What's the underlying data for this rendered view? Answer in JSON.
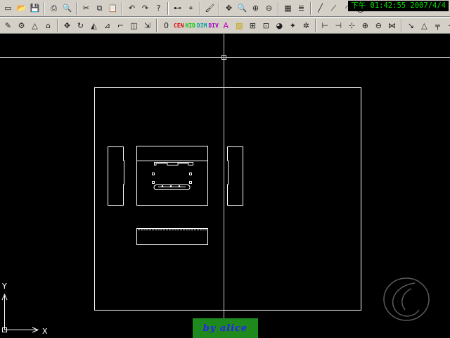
{
  "clock": {
    "text": "下午 01:42:55 2007/4/4"
  },
  "toolbar1": {
    "buttons": [
      {
        "name": "new-icon",
        "glyph": "▭"
      },
      {
        "name": "open-icon",
        "glyph": "📂"
      },
      {
        "name": "save-icon",
        "glyph": "💾"
      },
      {
        "sep": true
      },
      {
        "name": "print-icon",
        "glyph": "⎙"
      },
      {
        "name": "print-preview-icon",
        "glyph": "🔍"
      },
      {
        "sep": true
      },
      {
        "name": "cut-icon",
        "glyph": "✂"
      },
      {
        "name": "copy-icon",
        "glyph": "⧉"
      },
      {
        "name": "paste-icon",
        "glyph": "📋"
      },
      {
        "sep": true
      },
      {
        "name": "undo-icon",
        "glyph": "↶"
      },
      {
        "name": "redo-icon",
        "glyph": "↷"
      },
      {
        "name": "help-icon",
        "glyph": "?"
      },
      {
        "sep": true
      },
      {
        "name": "link-icon",
        "glyph": "⊷"
      },
      {
        "name": "snap-icon",
        "glyph": "⌖"
      },
      {
        "sep": true
      },
      {
        "name": "match-properties-icon",
        "glyph": "🖌"
      },
      {
        "sep": true
      },
      {
        "name": "pan-icon",
        "glyph": "✥"
      },
      {
        "name": "zoom-realtime-icon",
        "glyph": "🔍"
      },
      {
        "name": "zoom-window-icon",
        "glyph": "⊕"
      },
      {
        "name": "zoom-previous-icon",
        "glyph": "⊖"
      },
      {
        "sep": true
      },
      {
        "name": "properties-icon",
        "glyph": "▦"
      },
      {
        "name": "layers-stack-icon",
        "glyph": "≣"
      },
      {
        "sep": true
      },
      {
        "name": "line-icon",
        "glyph": "╱"
      },
      {
        "name": "polyline-icon",
        "glyph": "⟋"
      },
      {
        "name": "arc-icon",
        "glyph": "◜"
      },
      {
        "name": "circle-icon",
        "glyph": "◯"
      },
      {
        "name": "rectangle-icon",
        "glyph": "▭"
      },
      {
        "name": "target-icon",
        "glyph": "⊕"
      }
    ]
  },
  "toolbar2": {
    "buttons": [
      {
        "name": "edit-pencil-icon",
        "glyph": "✎"
      },
      {
        "name": "snap-settings-icon",
        "glyph": "⚙"
      },
      {
        "name": "measure-icon",
        "glyph": "△"
      },
      {
        "name": "region-icon",
        "glyph": "⌂"
      },
      {
        "sep": true
      },
      {
        "name": "move-icon",
        "glyph": "✥"
      },
      {
        "name": "rotate-icon",
        "glyph": "↻"
      },
      {
        "name": "mirror-icon",
        "glyph": "◭"
      },
      {
        "name": "trim-icon",
        "glyph": "⊿"
      },
      {
        "name": "fillet-icon",
        "glyph": "⌐"
      },
      {
        "name": "chamfer-icon",
        "glyph": "◫"
      },
      {
        "name": "stretch-icon",
        "glyph": "⇲"
      },
      {
        "sep": true
      },
      {
        "name": "layer-zero-icon",
        "glyph": "0"
      },
      {
        "name": "layer-cen-button",
        "text": "CEN",
        "color": "#e00000"
      },
      {
        "name": "layer-hid-button",
        "text": "HID",
        "color": "#00c800"
      },
      {
        "name": "layer-dim-button",
        "text": "DIM",
        "color": "#00a0a0"
      },
      {
        "name": "layer-div-button",
        "text": "DIV",
        "color": "#a000c0"
      },
      {
        "name": "text-icon",
        "glyph": "A",
        "color": "#c000c0"
      },
      {
        "name": "hatch-icon",
        "glyph": "▨",
        "color": "#c0a000"
      },
      {
        "name": "block-icon",
        "glyph": "⊞"
      },
      {
        "name": "insert-icon",
        "glyph": "⊡"
      },
      {
        "name": "color-wheel-icon",
        "glyph": "◕"
      },
      {
        "name": "paint-icon",
        "glyph": "✦"
      },
      {
        "name": "star-icon",
        "glyph": "✲"
      },
      {
        "sep": true
      },
      {
        "name": "dim-linear-icon",
        "glyph": "⊢"
      },
      {
        "name": "dim-aligned-icon",
        "glyph": "⊣"
      },
      {
        "name": "dim-ordinate-icon",
        "glyph": "⊹"
      },
      {
        "name": "dim-center-icon",
        "glyph": "⊕"
      },
      {
        "name": "dim-radius-icon",
        "glyph": "⊖"
      },
      {
        "name": "dim-angle-icon",
        "glyph": "⋈"
      },
      {
        "sep": true
      },
      {
        "name": "leader-icon",
        "glyph": "↘"
      },
      {
        "name": "tolerance-icon",
        "glyph": "△"
      },
      {
        "name": "baseline-icon",
        "glyph": "╤"
      },
      {
        "name": "continue-icon",
        "glyph": "╥"
      },
      {
        "name": "dim-edit-icon",
        "glyph": "╫"
      }
    ]
  },
  "ucs": {
    "x_label": "X",
    "y_label": "Y"
  },
  "signature": {
    "text": "by  alice"
  },
  "colors": {
    "background": "#000000",
    "geometry": "#ffffff",
    "crosshair": "#c8c8c8",
    "toolbar": "#d4d0c8",
    "clock_text": "#00e000"
  }
}
